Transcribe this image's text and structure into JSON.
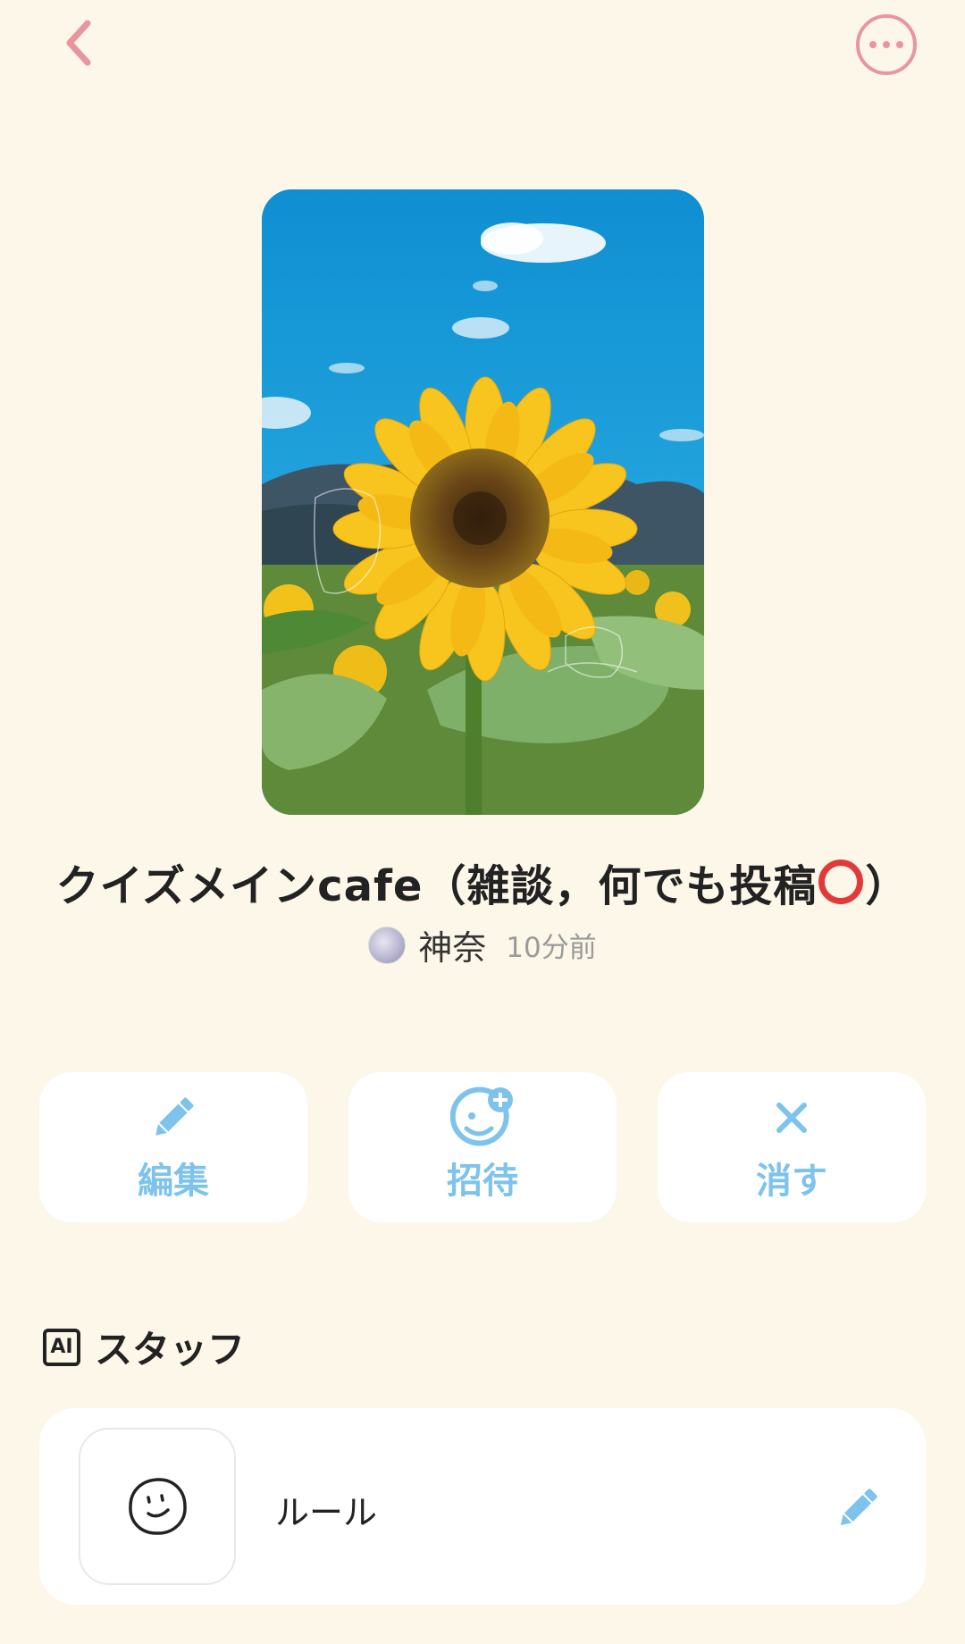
{
  "header": {
    "back_icon": "chevron-left-icon",
    "more_icon": "more-horizontal-icon",
    "accent_color": "#e9959f"
  },
  "room": {
    "title_prefix": "クイズメインcafe（雑談，何でも投稿",
    "title_suffix": "）",
    "author": "神奈",
    "time": "10分前"
  },
  "actions": [
    {
      "label": "編集",
      "icon": "pencil-icon"
    },
    {
      "label": "招待",
      "icon": "add-friend-icon"
    },
    {
      "label": "消す",
      "icon": "close-icon"
    }
  ],
  "action_color": "#7ec3ec",
  "staff": {
    "badge": "AI",
    "title": "スタッフ",
    "items": [
      {
        "name": "ルール",
        "icon": "smiley-face-icon",
        "edit_icon": "pencil-icon"
      }
    ]
  }
}
